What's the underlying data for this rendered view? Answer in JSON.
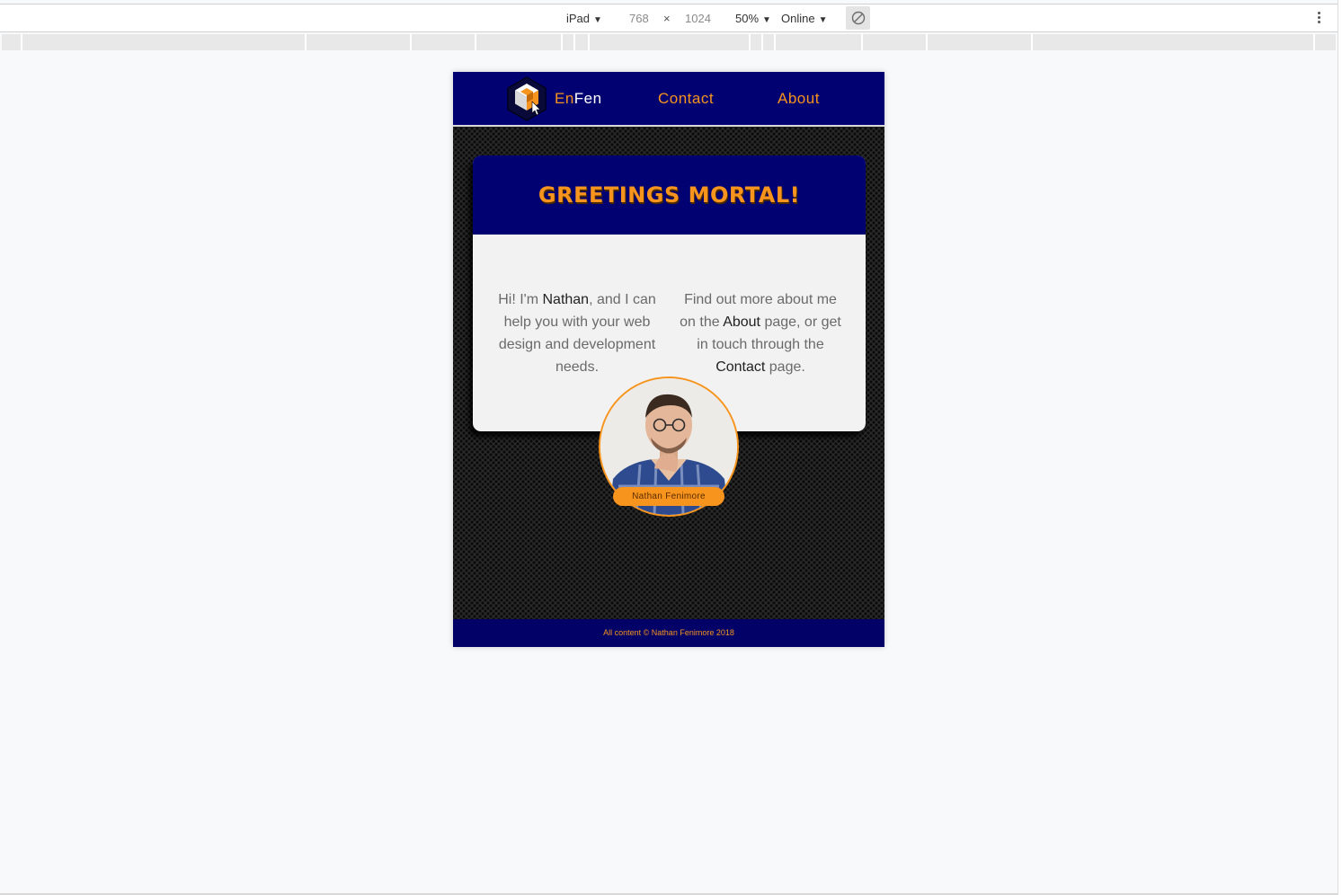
{
  "devtools": {
    "device": "iPad",
    "width": "768",
    "times": "×",
    "height": "1024",
    "zoom": "50%",
    "network": "Online",
    "icons": [
      "dropdown-caret",
      "rotate-icon",
      "more-vertical-icon"
    ]
  },
  "site": {
    "brand_en": "En",
    "brand_fen": "Fen",
    "nav": [
      "Contact",
      "About"
    ],
    "title": "GREETINGS MORTAL!",
    "col1": {
      "t1": "Hi! I'm ",
      "name": "Nathan",
      "t2": ", and I can help you with your web design and development needs."
    },
    "col2": {
      "t1": "Find out more about me on the ",
      "about": "About",
      "t2": " page, or get in touch through the ",
      "contact": "Contact",
      "t3": " page."
    },
    "profile_name": "Nathan Fenimore",
    "footer": "All content © Nathan Fenimore 2018",
    "colors": {
      "header_bg": "#010171",
      "accent": "#f7941d",
      "card_bg": "#f2f2f2",
      "page_bg": "#2b2b2b"
    }
  }
}
